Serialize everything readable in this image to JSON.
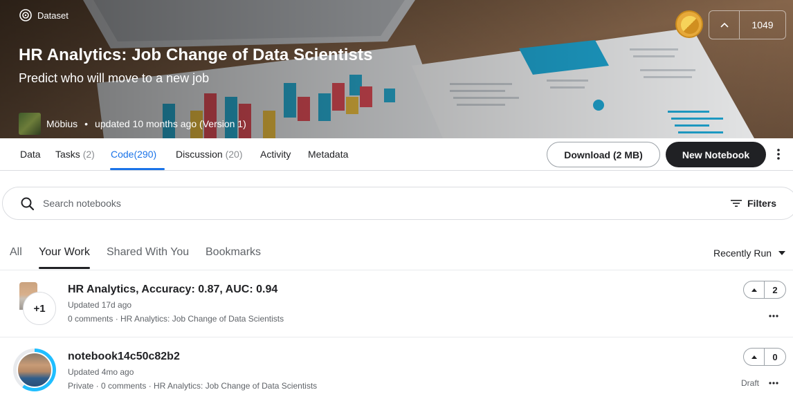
{
  "hero": {
    "badge": "Dataset",
    "title": "HR Analytics: Job Change of Data Scientists",
    "subtitle": "Predict who will move to a new job",
    "owner": "Möbius",
    "updated": "updated 10 months ago (Version 1)",
    "upvotes": "1049",
    "medal_color": "#e6a93a"
  },
  "tabs": [
    {
      "label": "Data",
      "count": ""
    },
    {
      "label": "Tasks",
      "count": "(2)"
    },
    {
      "label": "Code",
      "count": "(290)"
    },
    {
      "label": "Discussion",
      "count": "(20)"
    },
    {
      "label": "Activity",
      "count": ""
    },
    {
      "label": "Metadata",
      "count": ""
    }
  ],
  "actions": {
    "download": "Download (2 MB)",
    "new_notebook": "New Notebook"
  },
  "search": {
    "placeholder": "Search notebooks",
    "filters": "Filters"
  },
  "subtabs": [
    "All",
    "Your Work",
    "Shared With You",
    "Bookmarks"
  ],
  "sort": "Recently Run",
  "notebooks": [
    {
      "title": "HR Analytics, Accuracy: 0.87, AUC: 0.94",
      "updated": "Updated 17d ago",
      "sub": "0 comments · HR Analytics: Job Change of Data Scientists",
      "votes": "2",
      "extra_avatars": "+1"
    },
    {
      "title": "notebook14c50c82b2",
      "updated": "Updated 4mo ago",
      "sub": "Private · 0 comments · HR Analytics: Job Change of Data Scientists",
      "votes": "0",
      "status": "Draft"
    }
  ],
  "colors": {
    "accent": "#1a73e8",
    "dark_button": "#202124",
    "progress_ring": "#20beff"
  }
}
